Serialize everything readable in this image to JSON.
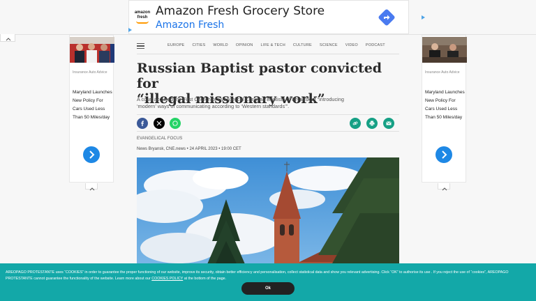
{
  "top_ad": {
    "brand_logo_text": "amazon fresh",
    "title": "Amazon Fresh Grocery Store",
    "subtitle": "Amazon Fresh"
  },
  "side_ads": [
    {
      "label": "Insurance Auto Advice",
      "headline": "Maryland Launches New Policy For Cars Used Less Than 50 Miles/day"
    },
    {
      "label": "Insurance Auto Advice",
      "headline": "Maryland Launches New Policy For Cars Used Less Than 50 Miles/day"
    }
  ],
  "nav": {
    "items": [
      "EUROPE",
      "CITIES",
      "WORLD",
      "OPINION",
      "LIFE & TECH",
      "CULTURE",
      "SCIENCE",
      "VIDEO",
      "PODCAST"
    ]
  },
  "article": {
    "headline_line1": "Russian Baptist pastor convicted for",
    "headline_line2": "“illegal missionary work”",
    "lead": "A court accused the First Church of Evangelical Christian Baptists of Bryansk of “introducing ‘modern’ ways of communicating according to ‘Western standards’”.",
    "section": "EVANGELICAL FOCUS",
    "byline": "News Bryansk, CNE.news • 24 APRIL 2023 • 19:00 CET"
  },
  "share_icons": [
    "facebook-icon",
    "x-icon",
    "whatsapp-icon",
    "link-icon",
    "print-icon",
    "email-icon"
  ],
  "cookie": {
    "text_before_link": "AREOPAGO PROTESTANTE uses “COOKIES” in order to guarantee the proper functioning of our website, improve its security, obtain better efficiency and personalisation, collect statistical data and show you relevant advertising. Click “OK” to authorise its use . If you reject the use of “cookies”, AREOPAGO PROTESTANTE cannot guarantee the functionality of the website. Learn more about our",
    "link": "COOKIES POLICY",
    "text_after_link": "at the bottom of the page.",
    "ok_label": "Ok"
  },
  "colors": {
    "cookie_bg": "#13a8a8",
    "amazon_blue": "#1a73e8",
    "ad_button": "#1e88e5",
    "accent_green": "#16a085"
  }
}
